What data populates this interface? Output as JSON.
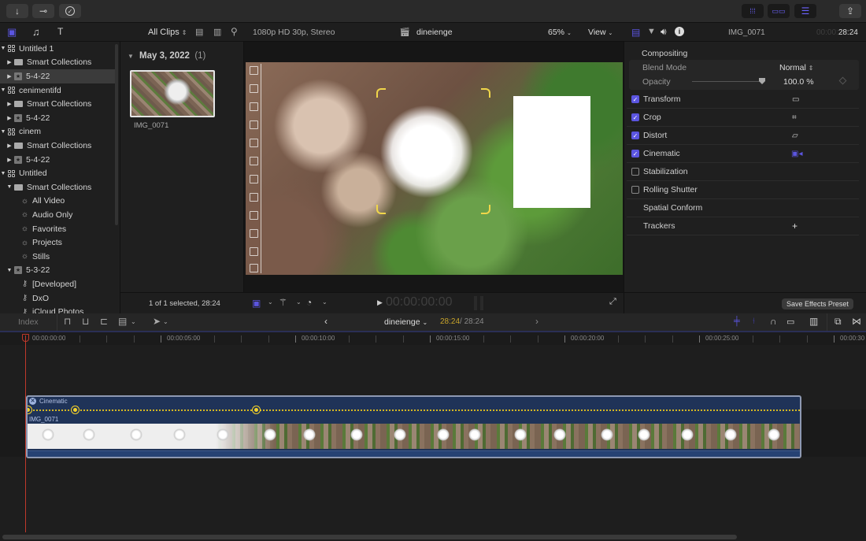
{
  "toolbar": {
    "left_buttons": [
      {
        "icon": "import-arrow-icon",
        "glyph": "↓"
      },
      {
        "icon": "key-icon",
        "glyph": "⚷"
      },
      {
        "icon": "checkmark-circle-icon",
        "glyph": "✓"
      }
    ],
    "right_buttons": [
      {
        "icon": "browser-toggle-icon"
      },
      {
        "icon": "timeline-toggle-icon"
      },
      {
        "icon": "inspector-toggle-icon"
      },
      {
        "icon": "share-icon"
      }
    ]
  },
  "browser": {
    "filter_label": "All Clips",
    "sidebar": [
      {
        "label": "Untitled 1",
        "type": "library",
        "expanded": true,
        "level": 0
      },
      {
        "label": "Smart Collections",
        "type": "folder",
        "expanded": false,
        "level": 1
      },
      {
        "label": "5-4-22",
        "type": "event",
        "expanded": false,
        "level": 1,
        "selected": true
      },
      {
        "label": "cenimentifd",
        "type": "library",
        "expanded": true,
        "level": 0
      },
      {
        "label": "Smart Collections",
        "type": "folder",
        "expanded": false,
        "level": 1
      },
      {
        "label": "5-4-22",
        "type": "event",
        "expanded": false,
        "level": 1
      },
      {
        "label": "cinem",
        "type": "library",
        "expanded": true,
        "level": 0
      },
      {
        "label": "Smart Collections",
        "type": "folder",
        "expanded": false,
        "level": 1
      },
      {
        "label": "5-4-22",
        "type": "event",
        "expanded": false,
        "level": 1
      },
      {
        "label": "Untitled",
        "type": "library",
        "expanded": true,
        "level": 0
      },
      {
        "label": "Smart Collections",
        "type": "folder",
        "expanded": true,
        "level": 1
      },
      {
        "label": "All Video",
        "type": "smart",
        "level": 2
      },
      {
        "label": "Audio Only",
        "type": "smart",
        "level": 2
      },
      {
        "label": "Favorites",
        "type": "smart",
        "level": 2
      },
      {
        "label": "Projects",
        "type": "smart",
        "level": 2
      },
      {
        "label": "Stills",
        "type": "smart",
        "level": 2
      },
      {
        "label": "5-3-22",
        "type": "event",
        "expanded": true,
        "level": 1
      },
      {
        "label": "[Developed]",
        "type": "keyword",
        "level": 2
      },
      {
        "label": "DxO",
        "type": "keyword",
        "level": 2
      },
      {
        "label": "iCloud Photos",
        "type": "keyword",
        "level": 2
      }
    ],
    "group_date": "May 3, 2022",
    "group_count": "(1)",
    "clip_name": "IMG_0071",
    "footer_status": "1 of 1 selected, 28:24"
  },
  "viewer": {
    "format": "1080p HD 30p, Stereo",
    "project_name": "dineienge",
    "zoom": "65%",
    "view_label": "View",
    "timecode": "00:00:00:00"
  },
  "inspector": {
    "clip_name": "IMG_0071",
    "timecode_dim": "00:00:",
    "timecode_bright": "28:24",
    "compositing_label": "Compositing",
    "blend_mode_label": "Blend Mode",
    "blend_mode_value": "Normal",
    "opacity_label": "Opacity",
    "opacity_value": "100.0",
    "opacity_unit": "%",
    "opacity_fraction": 1.0,
    "sections": [
      {
        "label": "Transform",
        "checked": true,
        "icon": "transform-icon"
      },
      {
        "label": "Crop",
        "checked": true,
        "icon": "crop-icon"
      },
      {
        "label": "Distort",
        "checked": true,
        "icon": "distort-icon"
      },
      {
        "label": "Cinematic",
        "checked": true,
        "icon": "cinematic-camera-icon"
      },
      {
        "label": "Stabilization",
        "checked": false
      },
      {
        "label": "Rolling Shutter",
        "checked": false
      },
      {
        "label": "Spatial Conform"
      },
      {
        "label": "Trackers",
        "action": "+"
      }
    ],
    "save_preset_label": "Save Effects Preset"
  },
  "timeline": {
    "index_label": "Index",
    "project_name": "dineienge",
    "position": "28:24",
    "duration": "/ 28:24",
    "ruler_labels": [
      "00:00:00:00",
      "00:00:05:00",
      "00:00:10:00",
      "00:00:15:00",
      "00:00:20:00",
      "00:00:25:00",
      "00:00:30"
    ],
    "clip": {
      "effect_label": "Cinematic",
      "name": "IMG_0071"
    }
  },
  "colors": {
    "accent": "#5b55e0",
    "keyframe": "#f5d22a",
    "playhead": "#c0392b",
    "clip_blue": "#1f3358"
  }
}
